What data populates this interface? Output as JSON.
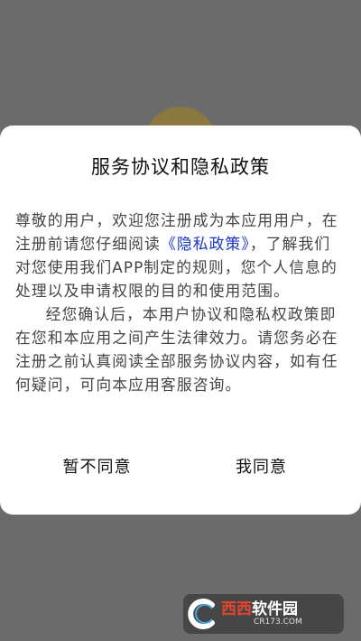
{
  "dialog": {
    "title": "服务协议和隐私政策",
    "intro_before_link": "尊敬的用户，欢迎您注册成为本应用用户，在注册前请您仔细阅读",
    "policy_link": "《隐私政策》",
    "intro_after_link": "，了解我们对您使用我们APP制定的规则，您个人信息的处理以及申请权限的目的和使用范围。",
    "paragraph2": "经您确认后，本用户协议和隐私权政策即在您和本应用之间产生法律效力。请您务必在注册之前认真阅读全部服务协议内容，如有任何疑问，可向本应用客服咨询。",
    "disagree_label": "暂不同意",
    "agree_label": "我同意"
  },
  "watermark": {
    "brand_red": "西西",
    "brand_white": "软件园",
    "url": "CR173.COM"
  },
  "colors": {
    "overlay": "#6b6b6b",
    "link": "#1a36c8",
    "body_text": "#444444"
  }
}
